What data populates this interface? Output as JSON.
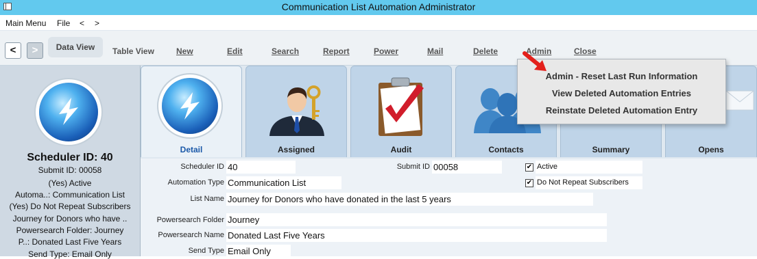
{
  "window": {
    "title": "Communication List Automation Administrator"
  },
  "menubar": {
    "items": [
      "Main Menu",
      "File",
      "<",
      ">"
    ]
  },
  "toolbar": {
    "back_label": "<",
    "forward_label": ">",
    "data_view": "Data View",
    "table_view": "Table View",
    "new": "New",
    "edit": "Edit",
    "search": "Search",
    "report": "Report",
    "power": "Power",
    "mail": "Mail",
    "delete": "Delete",
    "admin": "Admin",
    "close": "Close"
  },
  "admin_menu": {
    "items": [
      "Admin - Reset Last Run Information",
      "View Deleted Automation Entries",
      "Reinstate Deleted Automation Entry"
    ]
  },
  "left_panel": {
    "scheduler_id": "Scheduler ID: 40",
    "lines": [
      "Submit ID: 00058",
      "(Yes) Active",
      "Automa..: Communication List",
      "(Yes) Do Not Repeat Subscribers",
      "Journey for Donors who have ..",
      "Powersearch Folder: Journey",
      "P..: Donated Last Five Years",
      "Send Type: Email Only"
    ]
  },
  "tabs": [
    {
      "label": "Detail",
      "icon": "scheduler-icon"
    },
    {
      "label": "Assigned",
      "icon": "person-key-icon"
    },
    {
      "label": "Audit",
      "icon": "clipboard-check-icon"
    },
    {
      "label": "Contacts",
      "icon": "people-icon"
    },
    {
      "label": "Summary",
      "icon": "summary-icon"
    },
    {
      "label": "Opens",
      "icon": "envelope-icon"
    }
  ],
  "form": {
    "scheduler_id_label": "Scheduler ID",
    "scheduler_id": "40",
    "submit_id_label": "Submit ID",
    "submit_id": "00058",
    "active_label": "Active",
    "active_checked": true,
    "no_repeat_label": "Do Not Repeat Subscribers",
    "no_repeat_checked": true,
    "automation_type_label": "Automation Type",
    "automation_type": "Communication List",
    "list_name_label": "List Name",
    "list_name": "Journey for Donors who have donated in the last 5 years",
    "ps_folder_label": "Powersearch Folder",
    "ps_folder": "Journey",
    "ps_name_label": "Powersearch Name",
    "ps_name": "Donated Last Five Years",
    "send_type_label": "Send Type",
    "send_type": "Email Only"
  },
  "colors": {
    "titlebar": "#62c9ee",
    "accent_blue": "#1a58a8",
    "arrow_red": "#e3201b"
  }
}
